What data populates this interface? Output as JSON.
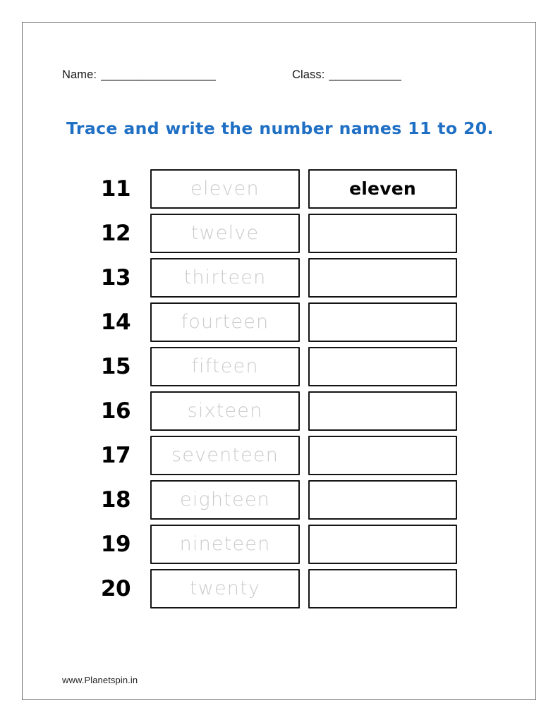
{
  "header": {
    "name_label": "Name:",
    "name_rule": "___________________",
    "class_label": "Class:",
    "class_rule": "____________"
  },
  "title": "Trace and write the number names 11 to 20.",
  "title_color": "#1f6fc4",
  "trace_color": "#cbcbcb",
  "box_border_color": "#141414",
  "rows": [
    {
      "number": "11",
      "trace_word": "eleven",
      "answer_word": "eleven"
    },
    {
      "number": "12",
      "trace_word": "twelve",
      "answer_word": ""
    },
    {
      "number": "13",
      "trace_word": "thirteen",
      "answer_word": ""
    },
    {
      "number": "14",
      "trace_word": "fourteen",
      "answer_word": ""
    },
    {
      "number": "15",
      "trace_word": "fifteen",
      "answer_word": ""
    },
    {
      "number": "16",
      "trace_word": "sixteen",
      "answer_word": ""
    },
    {
      "number": "17",
      "trace_word": "seventeen",
      "answer_word": ""
    },
    {
      "number": "18",
      "trace_word": "eighteen",
      "answer_word": ""
    },
    {
      "number": "19",
      "trace_word": "nineteen",
      "answer_word": ""
    },
    {
      "number": "20",
      "trace_word": "twenty",
      "answer_word": ""
    }
  ],
  "footer": "www.Planetspin.in"
}
